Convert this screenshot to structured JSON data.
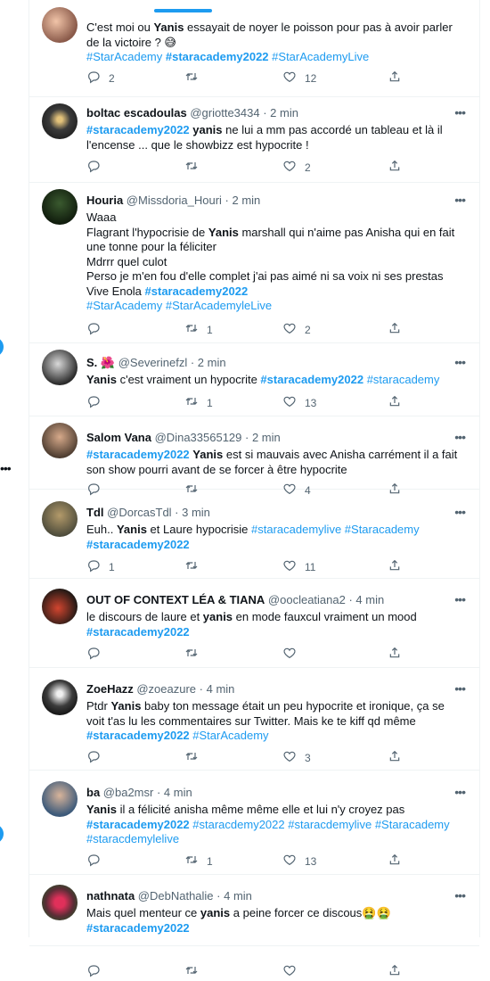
{
  "tweets": [
    {
      "name": "",
      "handle": "",
      "time": "",
      "paragraphs": [
        [
          {
            "t": "C'est moi ou "
          },
          {
            "t": "Yanis",
            "b": 1
          },
          {
            "t": " essayait de noyer le poisson pour pas à avoir parler de la victoire ? 😅"
          }
        ],
        [
          {
            "t": "#StarAcademy",
            "tag": 1
          },
          {
            "t": " "
          },
          {
            "t": "#staracademy2022",
            "tag": 1,
            "b": 1
          },
          {
            "t": " "
          },
          {
            "t": "#StarAcademyLive",
            "tag": 1
          }
        ]
      ],
      "counts": {
        "reply": "2",
        "retweet": "",
        "like": "12"
      }
    },
    {
      "name": "boltac escadoulas",
      "handle": "@griotte3434",
      "time": "2 min",
      "paragraphs": [
        [
          {
            "t": "#staracademy2022",
            "tag": 1,
            "b": 1
          },
          {
            "t": " "
          },
          {
            "t": "yanis",
            "b": 1
          },
          {
            "t": " ne lui a mm pas accordé un tableau et là il l'encense ... que le showbizz est hypocrite !"
          }
        ]
      ],
      "counts": {
        "reply": "",
        "retweet": "",
        "like": "2"
      }
    },
    {
      "name": "Houria",
      "handle": "@Missdoria_Houri",
      "time": "2 min",
      "paragraphs": [
        [
          {
            "t": "Waaa"
          }
        ],
        [
          {
            "t": "Flagrant l'hypocrisie de "
          },
          {
            "t": "Yanis",
            "b": 1
          },
          {
            "t": " marshall qui n'aime pas Anisha qui en fait une tonne pour la féliciter"
          }
        ],
        [
          {
            "t": "Mdrrr quel culot"
          }
        ],
        [
          {
            "t": "Perso je m'en fou d'elle complet j'ai pas aimé ni sa voix ni ses prestas"
          }
        ],
        [
          {
            "t": "Vive Enola "
          },
          {
            "t": "#staracademy2022",
            "tag": 1,
            "b": 1
          }
        ],
        [
          {
            "t": "#StarAcademy",
            "tag": 1
          },
          {
            "t": " "
          },
          {
            "t": "#StarAcademyleLive",
            "tag": 1
          }
        ]
      ],
      "counts": {
        "reply": "",
        "retweet": "1",
        "like": "2"
      }
    },
    {
      "name": "S. 🌺",
      "handle": "@Severinefzl",
      "time": "2 min",
      "paragraphs": [
        [
          {
            "t": "Yanis",
            "b": 1
          },
          {
            "t": " c'est vraiment un hypocrite  "
          },
          {
            "t": "#staracademy2022",
            "tag": 1,
            "b": 1
          },
          {
            "t": " "
          },
          {
            "t": "#staracademy",
            "tag": 1
          }
        ]
      ],
      "counts": {
        "reply": "",
        "retweet": "1",
        "like": "13"
      }
    },
    {
      "name": "Salom Vana",
      "handle": "@Dina33565129",
      "time": "2 min",
      "paragraphs": [
        [
          {
            "t": "#staracademy2022",
            "tag": 1,
            "b": 1
          },
          {
            "t": " "
          },
          {
            "t": "Yanis",
            "b": 1
          },
          {
            "t": " est si mauvais avec Anisha carrément il a fait son show pourri avant de se forcer à être hypocrite"
          }
        ]
      ],
      "counts": {
        "reply": "",
        "retweet": "",
        "like": "4"
      }
    },
    {
      "name": "Tdl",
      "handle": "@DorcasTdl",
      "time": "3 min",
      "paragraphs": [
        [
          {
            "t": "Euh.. "
          },
          {
            "t": "Yanis",
            "b": 1
          },
          {
            "t": " et Laure hypocrisie "
          },
          {
            "t": "#staracademylive",
            "tag": 1
          },
          {
            "t": " "
          },
          {
            "t": "#Staracademy",
            "tag": 1
          },
          {
            "t": " "
          },
          {
            "t": "#staracademy2022",
            "tag": 1,
            "b": 1
          }
        ]
      ],
      "counts": {
        "reply": "1",
        "retweet": "",
        "like": "11"
      }
    },
    {
      "name": "OUT OF CONTEXT LÉA & TIANA",
      "handle": "@oocleatiana2",
      "time": "4 min",
      "paragraphs": [
        [
          {
            "t": "le discours de laure et "
          },
          {
            "t": "yanis",
            "b": 1
          },
          {
            "t": " en mode fauxcul vraiment un mood "
          },
          {
            "t": "#staracademy2022",
            "tag": 1,
            "b": 1
          }
        ]
      ],
      "counts": {
        "reply": "",
        "retweet": "",
        "like": ""
      }
    },
    {
      "name": "ZoeHazz",
      "handle": "@zoeazure",
      "time": "4 min",
      "paragraphs": [
        [
          {
            "t": "Ptdr "
          },
          {
            "t": "Yanis",
            "b": 1
          },
          {
            "t": " baby ton message était un peu hypocrite et ironique, ça se voit t'as lu les commentaires sur Twitter. Mais ke te kiff qd même "
          },
          {
            "t": "#staracademy2022",
            "tag": 1,
            "b": 1
          },
          {
            "t": " "
          },
          {
            "t": "#StarAcademy",
            "tag": 1
          }
        ]
      ],
      "counts": {
        "reply": "",
        "retweet": "",
        "like": "3"
      }
    },
    {
      "name": "ba",
      "handle": "@ba2msr",
      "time": "4 min",
      "paragraphs": [
        [
          {
            "t": "Yanis",
            "b": 1
          },
          {
            "t": " il a félicité anisha même même elle et lui n'y croyez pas "
          },
          {
            "t": "#staracademy2022",
            "tag": 1,
            "b": 1
          },
          {
            "t": " "
          },
          {
            "t": "#staracdemy2022",
            "tag": 1
          },
          {
            "t": " "
          },
          {
            "t": "#staracdemylive",
            "tag": 1
          },
          {
            "t": " "
          },
          {
            "t": "#Staracademy",
            "tag": 1
          },
          {
            "t": " "
          },
          {
            "t": "#staracdemylelive",
            "tag": 1
          }
        ]
      ],
      "counts": {
        "reply": "",
        "retweet": "1",
        "like": "13"
      }
    },
    {
      "name": "nathnata",
      "handle": "@DebNathalie",
      "time": "4 min",
      "paragraphs": [
        [
          {
            "t": "Mais quel menteur ce "
          },
          {
            "t": "yanis",
            "b": 1
          },
          {
            "t": "  a peine  forcer ce discous🤮🤮 "
          },
          {
            "t": "#staracademy2022",
            "tag": 1,
            "b": 1
          }
        ]
      ],
      "counts": {
        "reply": "",
        "retweet": "",
        "like": ""
      }
    }
  ],
  "icons": {
    "reply": "reply-icon",
    "retweet": "retweet-icon",
    "like": "heart-icon",
    "share": "share-icon",
    "more": "more-icon"
  },
  "colors": {
    "accent": "#1d9bf0",
    "secondary_text": "#536471",
    "border": "#eff3f4"
  }
}
